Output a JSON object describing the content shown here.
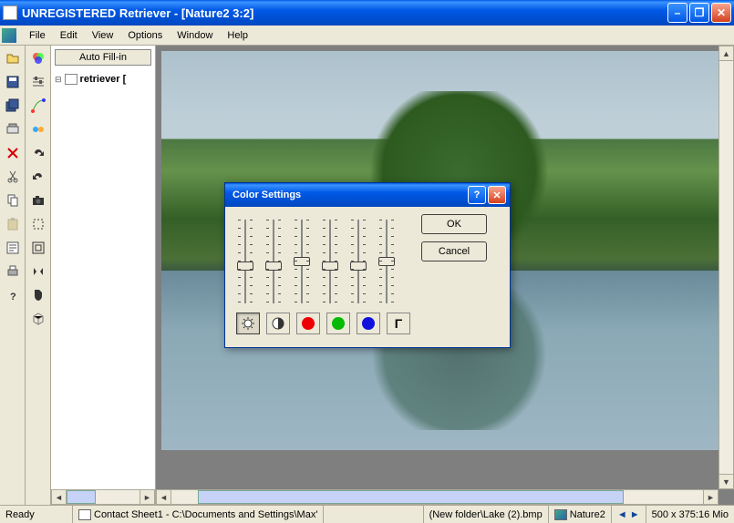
{
  "window": {
    "title": "UNREGISTERED Retriever - [Nature2 3:2]"
  },
  "menu": {
    "file": "File",
    "edit": "Edit",
    "view": "View",
    "options": "Options",
    "window": "Window",
    "help": "Help"
  },
  "tree": {
    "autofill": "Auto Fill-in",
    "item1": "retriever ["
  },
  "dialog": {
    "title": "Color Settings",
    "ok": "OK",
    "cancel": "Cancel",
    "gamma": "Γ"
  },
  "status": {
    "ready": "Ready",
    "sheet": "Contact Sheet1 - C:\\Documents and Settings\\Max'",
    "path": "(New folder\\Lake (2).bmp",
    "doc": "Nature2",
    "dims": "500 x 375:16 Mio"
  }
}
